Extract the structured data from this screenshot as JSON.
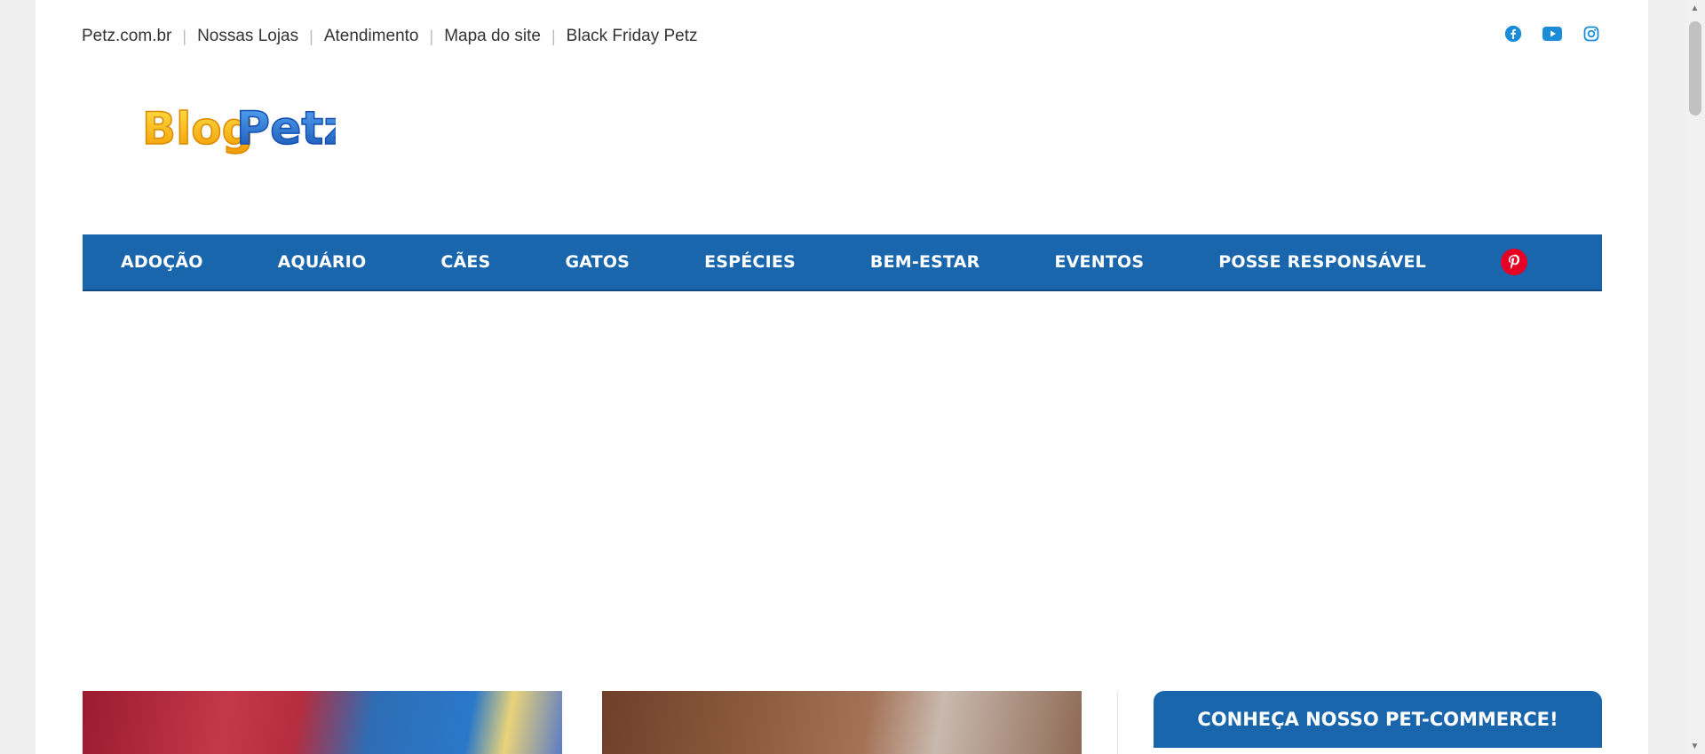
{
  "topbar": {
    "links": [
      "Petz.com.br",
      "Nossas Lojas",
      "Atendimento",
      "Mapa do site",
      "Black Friday Petz"
    ]
  },
  "social": {
    "icons": [
      "facebook-icon",
      "youtube-icon",
      "instagram-icon"
    ],
    "color": "#1a8cd8"
  },
  "logo": {
    "text_blog": "Blog",
    "text_petz": "Petz"
  },
  "nav": {
    "items": [
      "ADOÇÃO",
      "AQUÁRIO",
      "CÃES",
      "GATOS",
      "ESPÉCIES",
      "BEM-ESTAR",
      "EVENTOS",
      "POSSE RESPONSÁVEL"
    ],
    "pinterest_icon": "pinterest-icon",
    "background": "#1a66ad"
  },
  "sidebar": {
    "cta": "CONHEÇA NOSSO PET-COMMERCE!"
  }
}
